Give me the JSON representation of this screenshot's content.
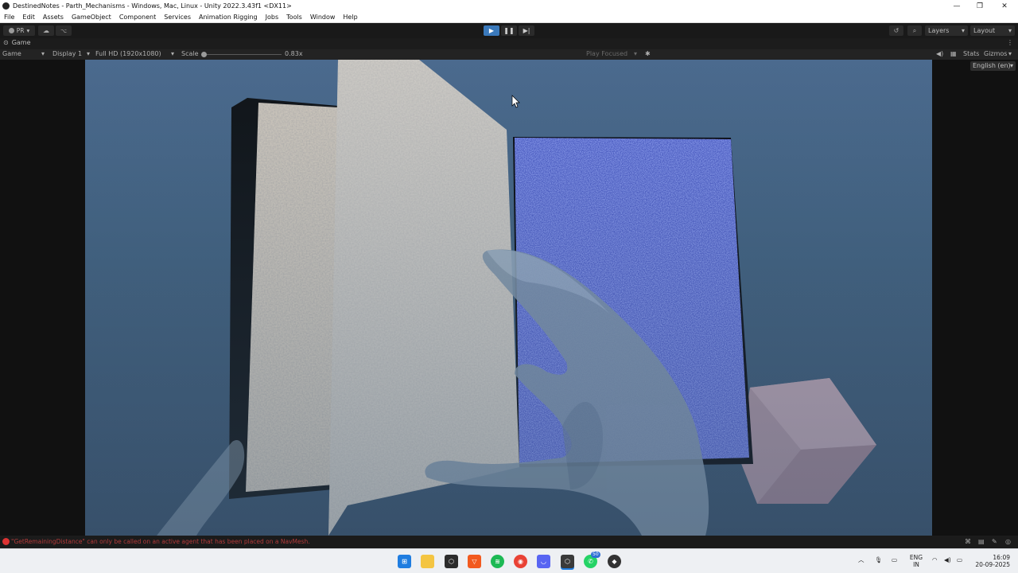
{
  "window": {
    "title": "DestinedNotes - Parth_Mechanisms - Windows, Mac, Linux - Unity 2022.3.43f1 <DX11>",
    "controls": [
      "—",
      "❐",
      "✕"
    ]
  },
  "menu": [
    "File",
    "Edit",
    "Assets",
    "GameObject",
    "Component",
    "Services",
    "Animation Rigging",
    "Jobs",
    "Tools",
    "Window",
    "Help"
  ],
  "toolbar": {
    "account_label": "PR",
    "layers_label": "Layers",
    "layout_label": "Layout"
  },
  "game_tab": {
    "label": "Game",
    "view_select": "Game",
    "display_select": "Display 1",
    "resolution_select": "Full HD (1920x1080)",
    "scale_label": "Scale",
    "scale_value": "0.83x",
    "play_mode": "Play Focused",
    "stats_label": "Stats",
    "gizmos_label": "Gizmos",
    "language": "English (en)"
  },
  "console": {
    "message": "\"GetRemainingDistance\" can only be called on an active agent that has been placed on a NavMesh."
  },
  "taskbar": {
    "whatsapp_badge": "50",
    "lang_primary": "ENG",
    "lang_secondary": "IN",
    "time": "16:09",
    "date": "20-09-2025"
  },
  "colors": {
    "play_active": "#3a79bb",
    "viewport_sky": "#4b6a8e",
    "book_page_pattern": "#3c4fc8",
    "pink_cube": "#a58f9f",
    "error": "#d33333"
  }
}
